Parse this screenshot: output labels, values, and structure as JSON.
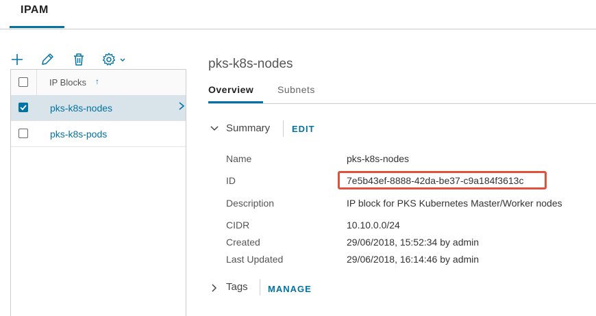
{
  "header": {
    "tab_label": "IPAM"
  },
  "toolbar": {
    "icons": [
      "add-icon",
      "edit-icon",
      "delete-icon",
      "settings-icon"
    ]
  },
  "grid": {
    "column_label": "IP Blocks",
    "sort_indicator": "↑",
    "rows": [
      {
        "name": "pks-k8s-nodes",
        "selected": true
      },
      {
        "name": "pks-k8s-pods",
        "selected": false
      }
    ]
  },
  "detail": {
    "title": "pks-k8s-nodes",
    "tabs": [
      {
        "label": "Overview",
        "active": true
      },
      {
        "label": "Subnets",
        "active": false
      }
    ],
    "summary": {
      "label": "Summary",
      "action": "EDIT",
      "fields": [
        {
          "label": "Name",
          "value": "pks-k8s-nodes"
        },
        {
          "label": "ID",
          "value": "7e5b43ef-8888-42da-be37-c9a184f3613c"
        },
        {
          "label": "Description",
          "value": "IP block for PKS Kubernetes Master/Worker nodes"
        },
        {
          "label": "CIDR",
          "value": "10.10.0.0/24"
        },
        {
          "label": "Created",
          "value": "29/06/2018, 15:52:34 by admin"
        },
        {
          "label": "Last Updated",
          "value": "29/06/2018, 16:14:46 by admin"
        }
      ]
    },
    "tags": {
      "label": "Tags",
      "action": "MANAGE"
    }
  },
  "colors": {
    "accent": "#0072a3",
    "highlight_border": "#e0503b",
    "selected_row": "#d9e4ea"
  }
}
